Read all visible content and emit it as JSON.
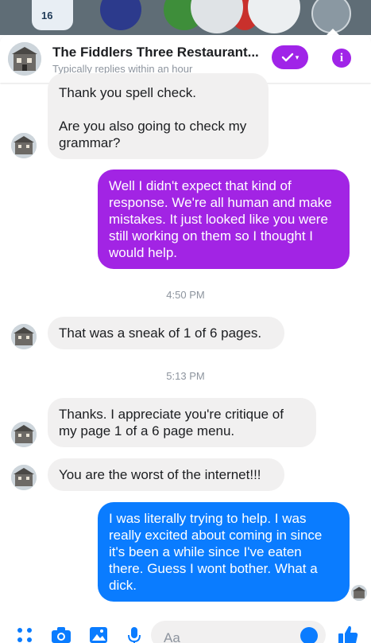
{
  "status_bar": {
    "calendar_day": "16"
  },
  "header": {
    "title": "The Fiddlers Three Restaurant...",
    "subtitle": "Typically replies within an hour"
  },
  "messages": [
    {
      "side": "in",
      "text": "Thank you spell check.\n\nAre you also going to check my grammar?"
    },
    {
      "side": "out",
      "text": "Well I didn't expect that kind of response. We're all human and make mistakes. It just looked like you were still working on them so I thought I would help."
    },
    {
      "side": "in",
      "text": "That was a sneak of 1 of 6 pages."
    },
    {
      "side": "in",
      "text": "Thanks. I appreciate you're critique of my page 1 of a 6 page menu."
    },
    {
      "side": "in",
      "text": "You are the worst of the internet!!!"
    },
    {
      "side": "out",
      "text": "I was literally trying to help. I was really excited about coming in since it's been a while since I've eaten there. Guess I wont bother. What a dick."
    }
  ],
  "timestamps": [
    "4:50 PM",
    "5:13 PM"
  ],
  "composer": {
    "placeholder": "Aa",
    "icons": [
      "grid-icon",
      "camera-icon",
      "image-icon",
      "microphone-icon",
      "emoji-icon",
      "thumbs-up-icon"
    ]
  },
  "colors": {
    "accent_purple": "#a224e4",
    "accent_blue": "#0a7cff",
    "incoming_bubble": "#f1f0f0"
  }
}
